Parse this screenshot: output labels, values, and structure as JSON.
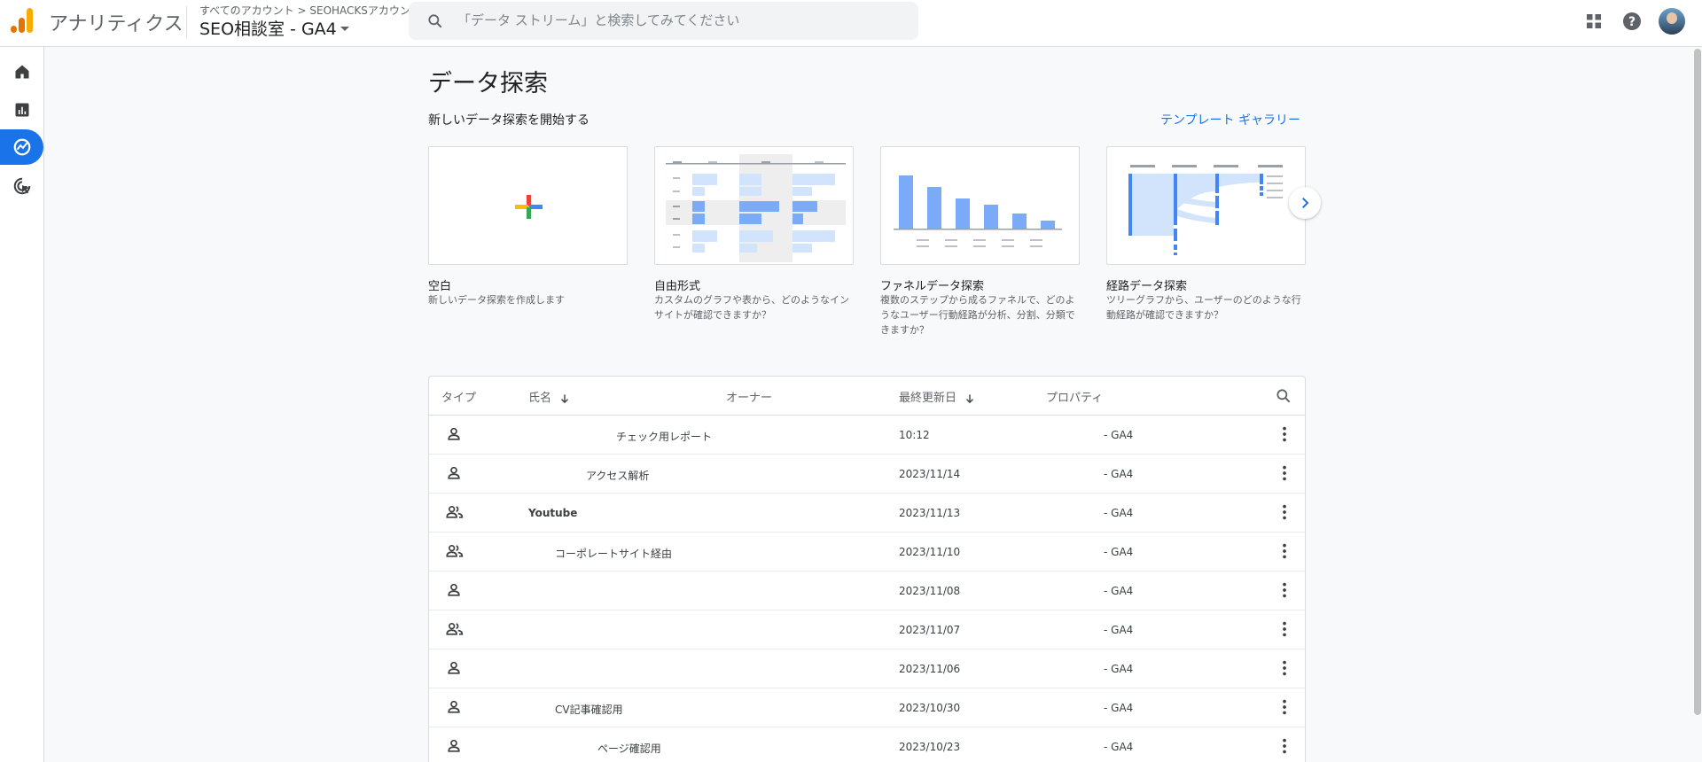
{
  "header": {
    "app_name": "アナリティクス",
    "breadcrumb": "すべてのアカウント > SEOHACKSアカウント",
    "property": "SEO相談室 - GA4",
    "search_placeholder": "「データ ストリーム」と検索してみてください"
  },
  "page": {
    "title": "データ探索",
    "start_label": "新しいデータ探索を開始する",
    "template_gallery": "テンプレート ギャラリー"
  },
  "templates": [
    {
      "title": "空白",
      "desc": "新しいデータ探索を作成します"
    },
    {
      "title": "自由形式",
      "desc": "カスタムのグラフや表から、どのようなインサイトが確認できますか？"
    },
    {
      "title": "ファネルデータ探索",
      "desc": "複数のステップから成るファネルで、どのようなユーザー行動経路が分析、分割、分類できますか？"
    },
    {
      "title": "経路データ探索",
      "desc": "ツリーグラフから、ユーザーのどのような行動経路が確認できますか？"
    }
  ],
  "table": {
    "headers": {
      "type": "タイプ",
      "name": "氏名",
      "owner": "オーナー",
      "updated": "最終更新日",
      "property": "プロパティ"
    },
    "rows": [
      {
        "type": "personal",
        "name": "チェック用レポート",
        "date": "10:12",
        "property": "- GA4"
      },
      {
        "type": "personal",
        "name": "アクセス解析",
        "date": "2023/11/14",
        "property": "- GA4"
      },
      {
        "type": "shared",
        "name": "Youtube",
        "date": "2023/11/13",
        "property": "- GA4"
      },
      {
        "type": "shared",
        "name": "コーポレートサイト経由",
        "date": "2023/11/10",
        "property": "- GA4"
      },
      {
        "type": "personal",
        "name": "",
        "date": "2023/11/08",
        "property": "- GA4"
      },
      {
        "type": "shared",
        "name": "",
        "date": "2023/11/07",
        "property": "- GA4"
      },
      {
        "type": "personal",
        "name": "",
        "date": "2023/11/06",
        "property": "- GA4"
      },
      {
        "type": "personal",
        "name": "CV記事確認用",
        "date": "2023/10/30",
        "property": "- GA4"
      },
      {
        "type": "personal",
        "name": "ページ確認用",
        "date": "2023/10/23",
        "property": "- GA4"
      }
    ]
  },
  "colors": {
    "accent": "#1a73e8",
    "logo_orange": "#f9ab00",
    "logo_dark_orange": "#e37400",
    "bar_blue": "#7baaf7",
    "bar_light": "#d2e3fc"
  }
}
